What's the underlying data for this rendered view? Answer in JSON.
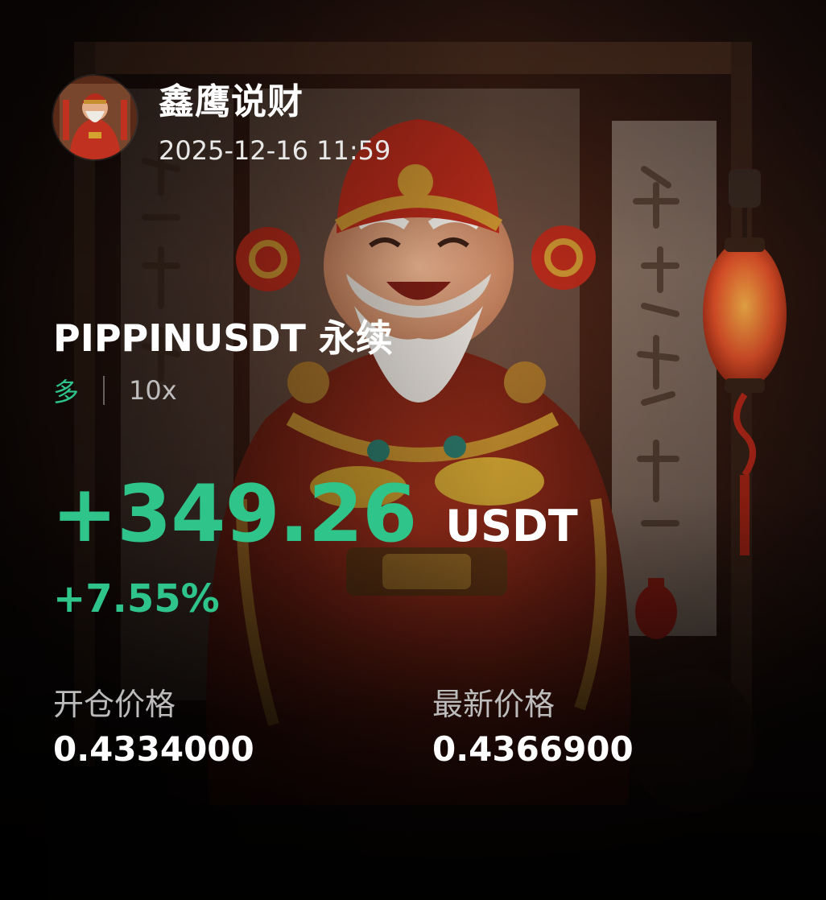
{
  "author": {
    "name": "鑫鹰说财",
    "timestamp": "2025-12-16 11:59"
  },
  "position": {
    "pair": "PIPPINUSDT 永续",
    "side": "多",
    "leverage": "10x",
    "pnl": "+349.26",
    "pnl_unit": "USDT",
    "pnl_percent": "+7.55%"
  },
  "prices": {
    "entry_label": "开仓价格",
    "entry_value": "0.4334000",
    "latest_label": "最新价格",
    "latest_value": "0.4366900"
  },
  "colors": {
    "profit_green": "#2ec48a",
    "background": "#120c0b",
    "label_gray": "#bcbcbc"
  },
  "icons": {
    "avatar": "god-of-wealth-avatar",
    "background": "god-of-wealth-illustration"
  }
}
